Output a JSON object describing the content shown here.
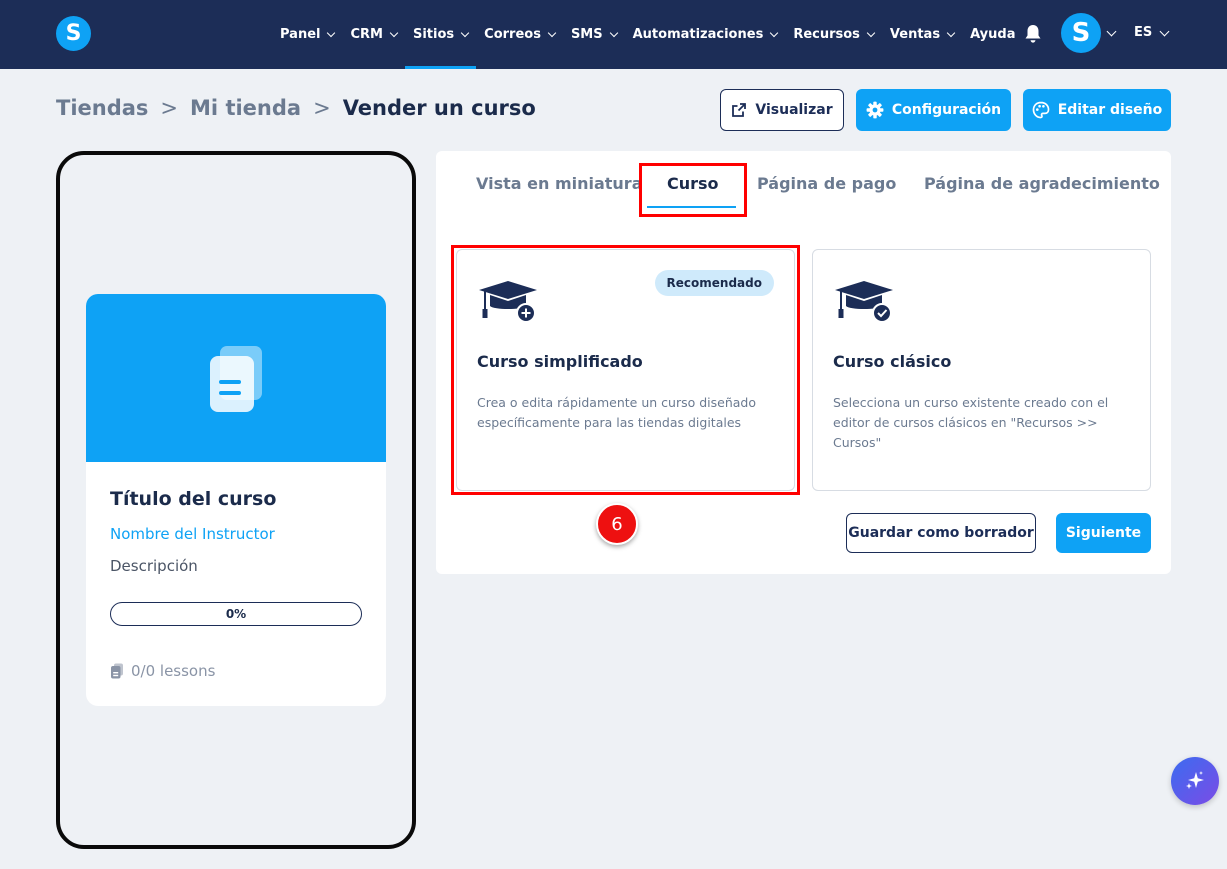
{
  "navbar": {
    "logo_letter": "S",
    "items": [
      {
        "label": "Panel",
        "has_dropdown": true
      },
      {
        "label": "CRM",
        "has_dropdown": true
      },
      {
        "label": "Sitios",
        "has_dropdown": true,
        "active": true
      },
      {
        "label": "Correos",
        "has_dropdown": true
      },
      {
        "label": "SMS",
        "has_dropdown": true
      },
      {
        "label": "Automatizaciones",
        "has_dropdown": true
      },
      {
        "label": "Recursos",
        "has_dropdown": true
      },
      {
        "label": "Ventas",
        "has_dropdown": true
      },
      {
        "label": "Ayuda",
        "has_dropdown": false
      }
    ],
    "bell_icon": "bell-icon",
    "avatar_letter": "S",
    "language": "ES"
  },
  "breadcrumb": {
    "items": [
      "Tiendas",
      "Mi tienda"
    ],
    "current": "Vender un curso",
    "separator": ">"
  },
  "header_buttons": {
    "visualize": "Visualizar",
    "configuration": "Configuración",
    "edit_design": "Editar diseño"
  },
  "preview": {
    "title": "Título del curso",
    "instructor": "Nombre del Instructor",
    "description": "Descripción",
    "progress_label": "0%",
    "progress_value": 0,
    "lessons": "0/0 lessons"
  },
  "tabs": {
    "thumbnail": "Vista en miniatura",
    "course": "Curso",
    "payment": "Página de pago",
    "thanks": "Página de agradecimiento",
    "active": "Curso"
  },
  "options": {
    "simplified": {
      "badge": "Recomendado",
      "title": "Curso simplificado",
      "description": "Crea o edita rápidamente un curso diseñado específicamente para las tiendas digitales"
    },
    "classic": {
      "title": "Curso clásico",
      "description": "Selecciona un curso existente creado con el editor de cursos clásicos en \"Recursos >> Cursos\""
    }
  },
  "actions": {
    "save_draft": "Guardar como borrador",
    "next": "Siguiente"
  },
  "annotation": {
    "step_number": "6"
  },
  "colors": {
    "navbar": "#1c2d57",
    "accent": "#0ea2f5",
    "highlight": "#ff0000"
  }
}
